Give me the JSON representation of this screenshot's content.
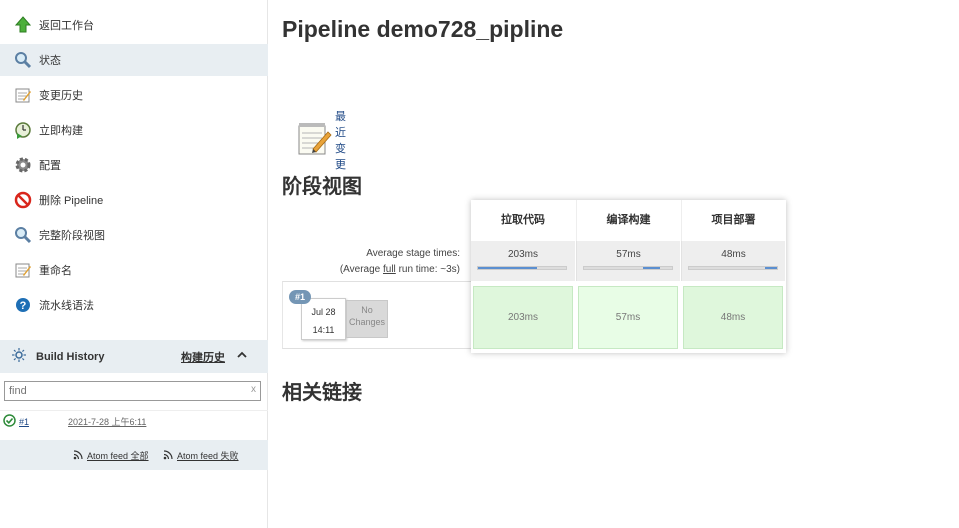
{
  "sidebar": {
    "items": [
      {
        "label": "返回工作台",
        "icon": "up-arrow-icon"
      },
      {
        "label": "状态",
        "icon": "magnifier-icon"
      },
      {
        "label": "变更历史",
        "icon": "notepad-icon"
      },
      {
        "label": "立即构建",
        "icon": "clock-play-icon"
      },
      {
        "label": "配置",
        "icon": "gear-icon"
      },
      {
        "label": "删除 Pipeline",
        "icon": "no-entry-icon"
      },
      {
        "label": "完整阶段视图",
        "icon": "magnifier-icon"
      },
      {
        "label": "重命名",
        "icon": "notepad-icon"
      },
      {
        "label": "流水线语法",
        "icon": "help-icon"
      }
    ],
    "active_index": 1
  },
  "build_history": {
    "title": "Build History",
    "trend_label": "构建历史",
    "search_placeholder": "find",
    "search_clear": "x",
    "builds": [
      {
        "number": "#1",
        "date": "2021-7-28 上午6:11",
        "status": "success"
      }
    ],
    "feeds": [
      {
        "label": "Atom feed 全部"
      },
      {
        "label": "Atom feed 失败"
      }
    ]
  },
  "main": {
    "title": "Pipeline demo728_pipline",
    "recent_changes": "最近变更",
    "stage_view_heading": "阶段视图",
    "related_links_heading": "相关链接"
  },
  "stage_view": {
    "avg_stage_times": "Average stage times:",
    "avg_run_prefix": "(Average ",
    "avg_run_link": "full",
    "avg_run_suffix": " run time: ~3s)",
    "stages": [
      {
        "name": "拉取代码",
        "avg": "203ms",
        "bar_start": 0.0,
        "bar_fraction": 0.67
      },
      {
        "name": "编译构建",
        "avg": "57ms",
        "bar_start": 0.67,
        "bar_fraction": 0.19
      },
      {
        "name": "项目部署",
        "avg": "48ms",
        "bar_start": 0.86,
        "bar_fraction": 0.14
      }
    ],
    "run": {
      "badge": "#1",
      "date": "Jul 28",
      "time": "14:11",
      "changes": "No Changes",
      "durations": [
        "203ms",
        "57ms",
        "48ms"
      ]
    },
    "colors": {
      "success_cell": "#dff7dc",
      "bar_fill": "#5b8fd0",
      "badge": "#7496b5"
    }
  }
}
